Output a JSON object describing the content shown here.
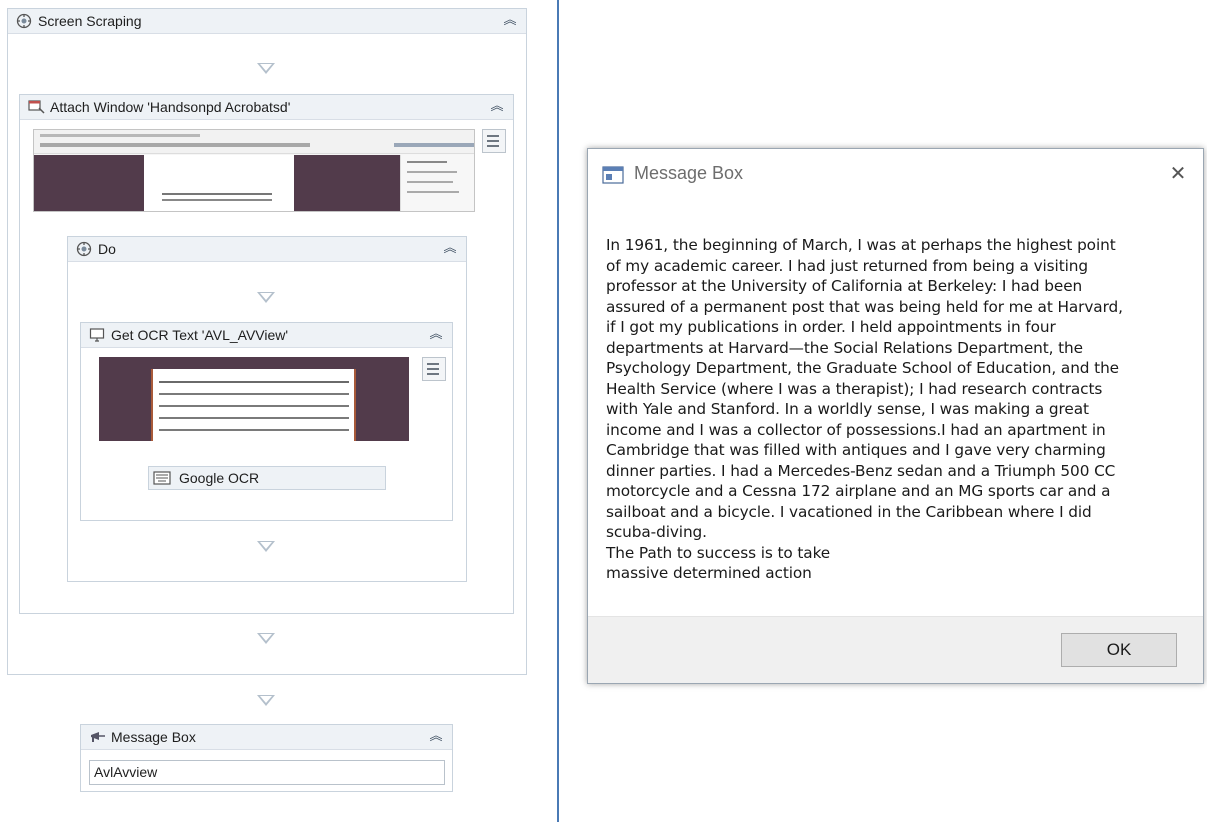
{
  "workflow": {
    "screen_scraping": {
      "title": "Screen Scraping"
    },
    "attach_window": {
      "title": "Attach Window 'Handsonpd Acrobatsd'"
    },
    "do": {
      "title": "Do"
    },
    "get_ocr": {
      "title": "Get OCR Text 'AVL_AVView'",
      "engine_label": "Google OCR"
    },
    "message_box": {
      "title": "Message Box",
      "input_value": "AvlAvview"
    }
  },
  "dialog": {
    "title": "Message Box",
    "body": "In 1961, the beginning of March, I was at perhaps the highest point\nof my academic career. I had just returned from being a visiting\nprofessor at the University of California at Berkeley: I had been\nassured of a permanent post that was being held for me at Harvard,\nif I got my publications in order. I held appointments in four\ndepartments at Harvard—the Social Relations Department, the\nPsychology Department, the Graduate School of Education, and the\nHealth Service (where I was a therapist); I had research contracts\nwith Yale and Stanford. In a worldly sense, I was making a great\nincome and I was a collector of possessions.I had an apartment in\nCambridge that was filled with antiques and I gave very charming\ndinner parties. I had a Mercedes-Benz sedan and a Triumph 500 CC\nmotorcycle and a Cessna 172 airplane and an MG sports car and a\nsailboat and a bicycle. I vacationed in the Caribbean where I did\nscuba-diving.\nThe Path to success is to take\nmassive determined action",
    "ok_label": "OK",
    "close_glyph": "✕"
  },
  "icons": {
    "collapse_glyph": "˄",
    "collapse_names": "collapse-chevron-icon"
  },
  "colors": {
    "divider": "#4a7ab5",
    "card_header": "#eef2f6",
    "preview_dark": "#523b4b",
    "preview_border": "#a85a3a"
  }
}
